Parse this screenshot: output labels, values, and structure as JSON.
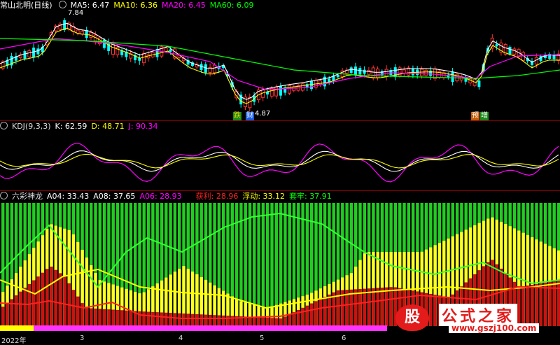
{
  "panel1": {
    "title": "常山北明(日线)",
    "ma": [
      {
        "label": "MA5: 6.47",
        "color": "#ffffff"
      },
      {
        "label": "MA10: 6.36",
        "color": "#ffff00"
      },
      {
        "label": "MA20: 6.45",
        "color": "#ff00ff"
      },
      {
        "label": "MA60: 6.09",
        "color": "#00ff00"
      }
    ],
    "high_label": "7.84",
    "low_label": "4.87",
    "mark_die": "跌",
    "mark_cai": "财",
    "mark_yu": "预",
    "mark_zeng": "增"
  },
  "panel2": {
    "title": "KDJ(9,3,3)",
    "k": "K: 62.59",
    "d": "D: 48.71",
    "j": "J: 90.34"
  },
  "panel3": {
    "title": "六彩神龙",
    "a04": "A04: 33.43",
    "a08": "A08: 37.65",
    "a06": "A06: 28.93",
    "huoli": "获利: 28.96",
    "fudong": "浮动: 33.12",
    "taolao": "套牢: 37.91"
  },
  "axis_labels": [
    "2022年",
    "3",
    "4",
    "5",
    "6"
  ],
  "watermark": {
    "logo": "股",
    "title": "公式之家",
    "url": "www.gszj100.com"
  },
  "colors": {
    "up": "#ff3232",
    "down": "#00ffff",
    "bg": "#000000"
  }
}
